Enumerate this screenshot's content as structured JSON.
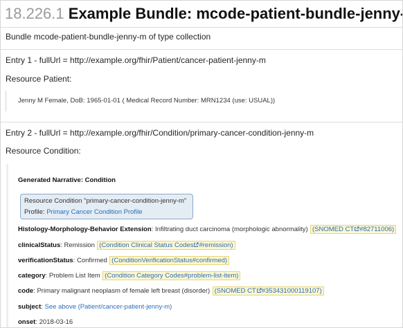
{
  "heading": {
    "number": "18.226.1",
    "title": "Example Bundle: mcode-patient-bundle-jenny-m"
  },
  "summary": "Bundle mcode-patient-bundle-jenny-m of type collection",
  "entry1": {
    "header": "Entry 1 - fullUrl = http://example.org/fhir/Patient/cancer-patient-jenny-m",
    "resource_title": "Resource Patient:",
    "narrative": "Jenny M Female, DoB: 1965-01-01 ( Medical Record Number: MRN1234 (use: USUAL))"
  },
  "entry2": {
    "header": "Entry 2 - fullUrl = http://example.org/fhir/Condition/primary-cancer-condition-jenny-m",
    "resource_title": "Resource Condition:",
    "generated_narrative": "Generated Narrative: Condition",
    "profile_box": {
      "line1": "Resource Condition \"primary-cancer-condition-jenny-m\"",
      "profile_prefix": "Profile: ",
      "profile_link": "Primary Cancer Condition Profile"
    },
    "fields": {
      "histology": {
        "label": "Histology-Morphology-Behavior Extension",
        "sep": ": ",
        "value": "Infiltrating duct carcinoma (morphologic abnormality)",
        "code_system": "SNOMED CT",
        "code": "#82711006)",
        "open": "("
      },
      "clinical_status": {
        "label": "clinicalStatus",
        "sep": ": ",
        "value": "Remission",
        "code_system": "Condition Clinical Status Codes",
        "code": "#remission)",
        "open": "("
      },
      "verification_status": {
        "label": "verificationStatus",
        "sep": ": ",
        "value": "Confirmed",
        "code_system": "ConditionVerificationStatus",
        "code": "#confirmed)",
        "open": "("
      },
      "category": {
        "label": "category",
        "sep": ": ",
        "value": "Problem List Item",
        "code_system": "Condition Category Codes",
        "code": "#problem-list-item)",
        "open": "("
      },
      "code": {
        "label": "code",
        "sep": ": ",
        "value": "Primary malignant neoplasm of female left breast (disorder)",
        "code_system": "SNOMED CT",
        "code": "#353431000119107)",
        "open": "("
      },
      "subject": {
        "label": "subject",
        "sep": ": ",
        "link": "See above (Patient/cancer-patient-jenny-m)"
      },
      "onset": {
        "label": "onset",
        "sep": ": ",
        "value": "2018-03-16"
      }
    }
  },
  "colors": {
    "link": "#2a6ebb",
    "highlight_bg": "#fdf7d0",
    "highlight_border": "#e8d477",
    "profile_box_bg": "#e4ecf4",
    "profile_box_border": "#8aa8c8",
    "heading_number": "#9a9a9a"
  }
}
